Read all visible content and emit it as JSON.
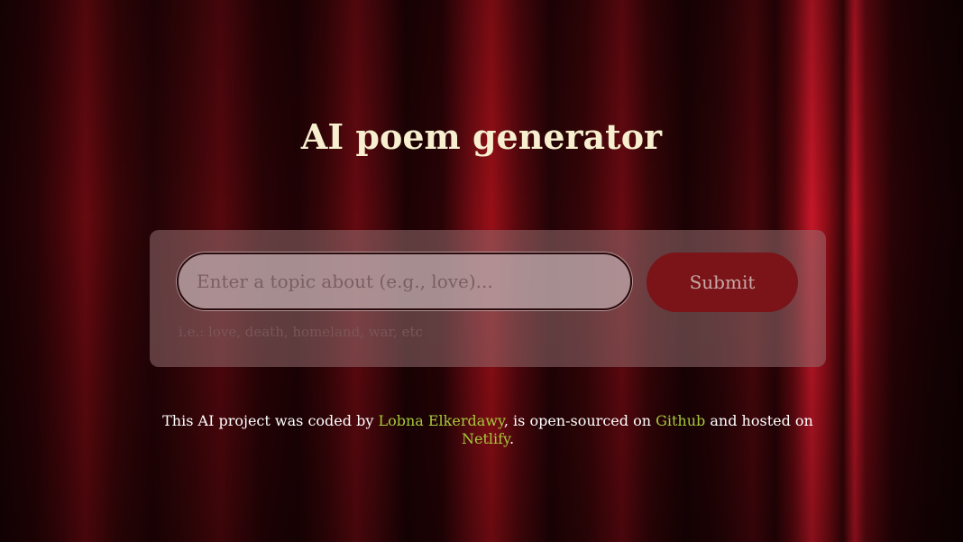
{
  "page": {
    "title": "AI poem generator"
  },
  "form": {
    "input_placeholder": "Enter a topic about (e.g., love)...",
    "input_value": "",
    "submit_label": "Submit",
    "hint": "i.e.: love, death, homeland, war, etc"
  },
  "footer": {
    "text_1": "This AI project was coded by ",
    "author_link": "Lobna Elkerdawy",
    "text_2": ", is open-sourced on ",
    "github_link": "Github",
    "text_3": " and hosted on ",
    "netlify_link": "Netlify",
    "text_4": "."
  },
  "colors": {
    "title": "#f7efcf",
    "link": "#a6c83b",
    "submit_bg": "#7a1418",
    "background": "#3a0508"
  }
}
